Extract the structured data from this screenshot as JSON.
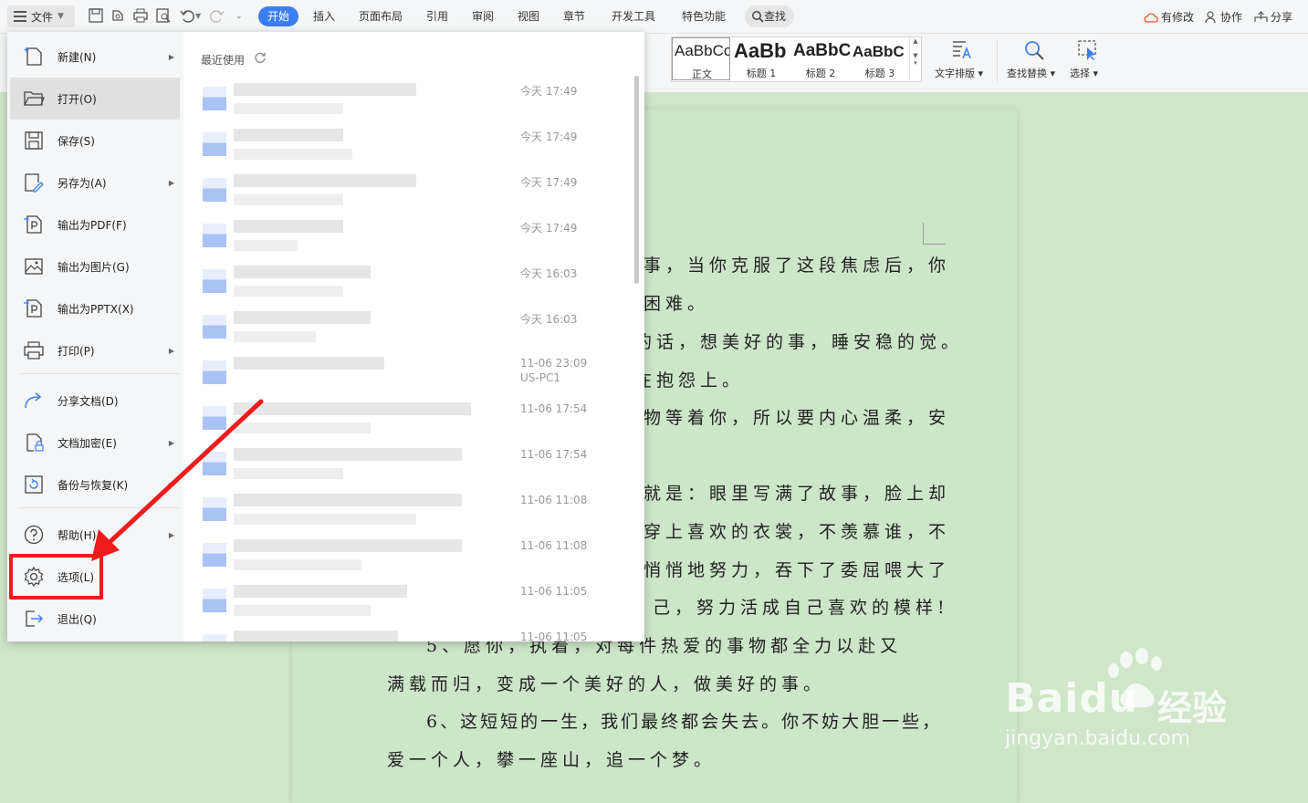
{
  "menubar": {
    "file_label": "文件",
    "tabs": [
      "开始",
      "插入",
      "页面布局",
      "引用",
      "审阅",
      "视图",
      "章节",
      "开发工具",
      "特色功能"
    ],
    "active_tab": "开始",
    "search_label": "查找",
    "actions": {
      "changes": "有修改",
      "collab": "协作",
      "share": "分享"
    }
  },
  "ribbon": {
    "styles": [
      {
        "preview": "AaBbCcI",
        "name": "正文"
      },
      {
        "preview": "AaBb",
        "name": "标题 1"
      },
      {
        "preview": "AaBbC",
        "name": "标题 2"
      },
      {
        "preview": "AaBbC",
        "name": "标题 3"
      }
    ],
    "tools": {
      "text_layout": "文字排版",
      "find_replace": "查找替换",
      "select": "选择"
    }
  },
  "file_menu": {
    "items": [
      {
        "label": "新建(N)",
        "icon": "new-doc-icon",
        "submenu": true
      },
      {
        "label": "打开(O)",
        "icon": "folder-open-icon",
        "submenu": false
      },
      {
        "label": "保存(S)",
        "icon": "save-icon",
        "submenu": false
      },
      {
        "label": "另存为(A)",
        "icon": "save-as-icon",
        "submenu": true
      },
      {
        "label": "输出为PDF(F)",
        "icon": "pdf-export-icon",
        "submenu": false
      },
      {
        "label": "输出为图片(G)",
        "icon": "image-export-icon",
        "submenu": false
      },
      {
        "label": "输出为PPTX(X)",
        "icon": "pptx-export-icon",
        "submenu": false
      },
      {
        "label": "打印(P)",
        "icon": "print-icon",
        "submenu": true
      },
      {
        "label": "分享文档(D)",
        "icon": "share-icon",
        "submenu": false
      },
      {
        "label": "文档加密(E)",
        "icon": "encrypt-icon",
        "submenu": true
      },
      {
        "label": "备份与恢复(K)",
        "icon": "backup-icon",
        "submenu": true
      },
      {
        "label": "帮助(H)",
        "icon": "help-icon",
        "submenu": true
      },
      {
        "label": "选项(L)",
        "icon": "gear-icon",
        "submenu": false
      },
      {
        "label": "退出(Q)",
        "icon": "exit-icon",
        "submenu": false
      }
    ],
    "recent_title": "最近使用",
    "recent": [
      {
        "time": "今天 17:49",
        "sub": ""
      },
      {
        "time": "今天 17:49",
        "sub": ""
      },
      {
        "time": "今天 17:49",
        "sub": ""
      },
      {
        "time": "今天 17:49",
        "sub": ""
      },
      {
        "time": "今天 16:03",
        "sub": ""
      },
      {
        "time": "今天 16:03",
        "sub": ""
      },
      {
        "time": "11-06 23:09",
        "sub": "US-PC1"
      },
      {
        "time": "11-06 17:54",
        "sub": ""
      },
      {
        "time": "11-06 17:54",
        "sub": ""
      },
      {
        "time": "11-06 11:08",
        "sub": ""
      },
      {
        "time": "11-06 11:08",
        "sub": ""
      },
      {
        "time": "11-06 11:05",
        "sub": ""
      },
      {
        "time": "11-06 11:05",
        "sub": ""
      }
    ]
  },
  "document": {
    "lines": [
      "事，当你克服了这段焦虑后，你",
      "困难。",
      "的话，想美好的事，睡安稳的觉。",
      "在抱怨上。",
      "物等着你，所以要内心温柔，安",
      "就是：眼里写满了故事，脸上却",
      "穿上喜欢的衣裳，不羡慕谁，不",
      "悄悄地努力，吞下了委屈喂大了",
      "己，努力活成自己喜欢的模样!",
      "5、愿你，执着，对每件热爱的事物都全力以赴又",
      "满载而归，变成一个美好的人，做美好的事。",
      "6、这短短的一生，我们最终都会失去。你不妨大胆一些，",
      "爱一个人，攀一座山，追一个梦。"
    ]
  },
  "watermark": {
    "brand": "Baidu",
    "brand_cn": "经验",
    "url": "jingyan.baidu.com"
  },
  "colors": {
    "accent": "#3b7ff2",
    "highlight": "#ee1c1c",
    "doc_bg": "#cce6c8"
  }
}
